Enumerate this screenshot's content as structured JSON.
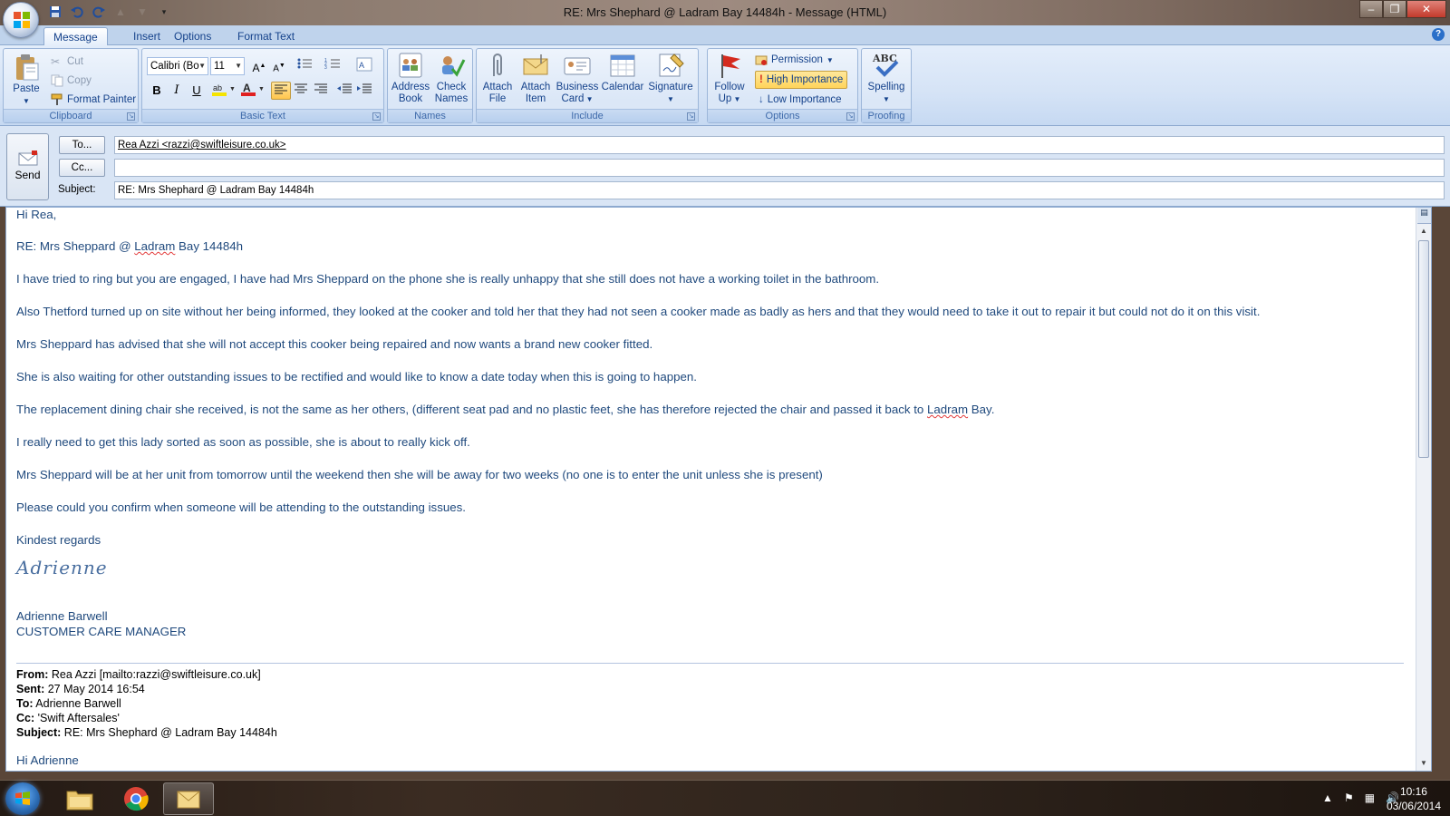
{
  "window": {
    "title": "RE: Mrs Shephard @ Ladram Bay 14484h - Message (HTML)"
  },
  "quick_access": [
    "save-icon",
    "undo-icon",
    "redo-icon",
    "up-arrow-icon",
    "down-arrow-icon",
    "customize-icon"
  ],
  "tabs": [
    {
      "label": "Message",
      "active": true
    },
    {
      "label": "Insert",
      "active": false
    },
    {
      "label": "Options",
      "active": false
    },
    {
      "label": "Format Text",
      "active": false
    }
  ],
  "ribbon": {
    "clipboard": {
      "label": "Clipboard",
      "paste": "Paste",
      "cut": "Cut",
      "copy": "Copy",
      "format_painter": "Format Painter"
    },
    "basic_text": {
      "label": "Basic Text",
      "font": "Calibri (Bo",
      "size": "11",
      "bold": "B",
      "italic": "I",
      "underline": "U"
    },
    "names": {
      "label": "Names",
      "address_book_1": "Address",
      "address_book_2": "Book",
      "check_names_1": "Check",
      "check_names_2": "Names"
    },
    "include": {
      "label": "Include",
      "attach_file_1": "Attach",
      "attach_file_2": "File",
      "attach_item_1": "Attach",
      "attach_item_2": "Item",
      "business_card_1": "Business",
      "business_card_2": "Card",
      "calendar": "Calendar",
      "signature": "Signature"
    },
    "options": {
      "label": "Options",
      "follow_up_1": "Follow",
      "follow_up_2": "Up",
      "permission": "Permission",
      "high_importance": "High Importance",
      "low_importance": "Low Importance"
    },
    "proofing": {
      "label": "Proofing",
      "spelling": "Spelling",
      "abc": "ABC"
    }
  },
  "header": {
    "send": "Send",
    "to_button": "To...",
    "cc_button": "Cc...",
    "subject_label": "Subject:",
    "to_value": "Rea Azzi <razzi@swiftleisure.co.uk>",
    "cc_value": "",
    "subject_value": "RE: Mrs Shephard @ Ladram Bay 14484h"
  },
  "message": {
    "greeting": "Hi Rea,",
    "re_line_a": "RE: Mrs Sheppard @ ",
    "re_line_b": "Ladram",
    "re_line_c": " Bay 14484h",
    "p1": "I have tried to ring but you are engaged, I have had Mrs Sheppard on the phone she is really unhappy that she still does not have a working toilet in the bathroom.",
    "p2": "Also Thetford turned up on site without her being informed, they looked at the cooker and told her that they had not seen a cooker made as badly as hers and that they would need to take it out to repair it but could not do it on this visit.",
    "p3": "Mrs Sheppard has advised that she will not accept this cooker being repaired and now wants a brand new cooker fitted.",
    "p4": "She is also waiting for other outstanding issues to be rectified and would like to know a date today when this is going to happen.",
    "p5a": "The replacement dining chair she received, is not the same as her others, (different seat pad and no plastic feet, she has therefore rejected the chair and passed it back to ",
    "p5b": "Ladram",
    "p5c": " Bay.",
    "p6": "I really need to get this lady sorted as soon as possible, she is about to really kick off.",
    "p7": "Mrs Sheppard will be at her unit from tomorrow until the weekend then she will be away for two weeks (no one is to enter the unit unless she is present)",
    "p8": "Please could you confirm when someone will be attending to the outstanding issues.",
    "closing": "Kindest regards",
    "signature_script": "Adrienne",
    "sig_name": "Adrienne Barwell",
    "sig_title": "CUSTOMER CARE MANAGER"
  },
  "quoted": {
    "from_label": "From:",
    "from_value": " Rea Azzi [mailto:razzi@swiftleisure.co.uk]",
    "sent_label": "Sent:",
    "sent_value": " 27 May 2014 16:54",
    "to_label": "To:",
    "to_value": " Adrienne Barwell",
    "cc_label": "Cc:",
    "cc_value": " 'Swift Aftersales'",
    "subject_label": "Subject:",
    "subject_value": " RE: Mrs Shephard @ Ladram Bay 14484h",
    "greeting": "Hi Adrienne"
  },
  "taskbar": {
    "time": "10:16",
    "date": "03/06/2014",
    "apps": [
      "file-explorer-icon",
      "chrome-icon",
      "outlook-icon"
    ]
  }
}
